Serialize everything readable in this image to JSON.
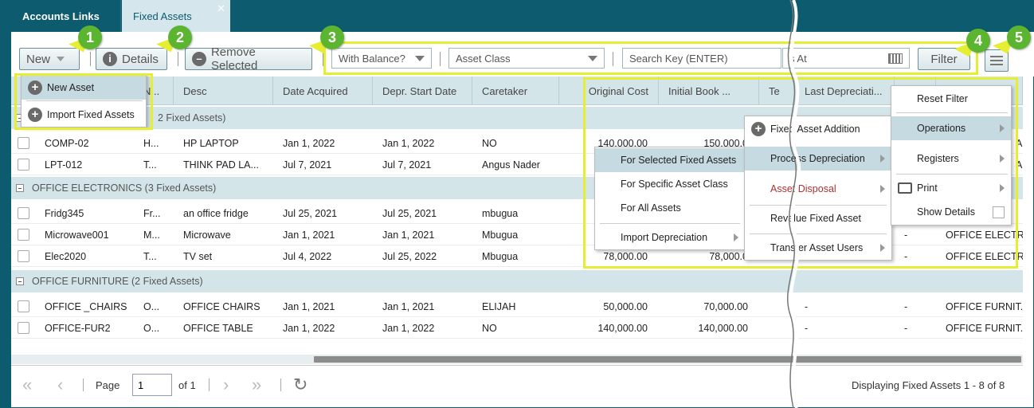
{
  "tabs": [
    {
      "label": "Accounts Links"
    },
    {
      "label": "Fixed Assets",
      "close": "✕"
    }
  ],
  "toolbar": {
    "new_label": "New",
    "details_label": "Details",
    "remove_label": "Remove Selected",
    "balance_value": "With Balance?",
    "asset_class_placeholder": "Asset Class",
    "search_placeholder": "Search Key (ENTER)",
    "as_at_placeholder": "s At",
    "filter_label": "Filter"
  },
  "new_menu": {
    "items": [
      "New Asset",
      "Import Fixed Assets"
    ]
  },
  "columns": [
    "N...",
    "Desc",
    "Date Acquired",
    "Depr. Start Date",
    "Caretaker",
    "Original Cost",
    "Initial Book ...",
    "Te",
    "Last Depreciati...",
    "",
    "Asset Class"
  ],
  "groups": [
    {
      "label": "2 Fixed Assets)"
    },
    {
      "label": "OFFICE ELECTRONICS (3 Fixed Assets)"
    },
    {
      "label": "OFFICE FURNITURE (2 Fixed Assets)"
    }
  ],
  "rows": [
    {
      "code": "COMP-02",
      "n": "H...",
      "desc": "HP LAPTOP",
      "acq": "Jan 1, 2022",
      "depr": "Jan 1, 2022",
      "caretaker": "NO",
      "cost": "140,000.00",
      "book": "150,000.0",
      "last": "",
      "dash": "",
      "cls": "A..."
    },
    {
      "code": "LPT-012",
      "n": "T...",
      "desc": "THINK PAD LA...",
      "acq": "Jul 7, 2021",
      "depr": "Jul 7, 2021",
      "caretaker": "Angus Nader",
      "cost": "",
      "book": "",
      "last": "",
      "dash": "",
      "cls": "A..."
    },
    {
      "code": "Fridg345",
      "n": "Fr...",
      "desc": "an office fridge",
      "acq": "Jul 25, 2021",
      "depr": "Jul 25, 2021",
      "caretaker": "mbugua",
      "cost": "",
      "book": "",
      "last": "",
      "dash": "",
      "cls": ""
    },
    {
      "code": "Microwave001",
      "n": "M...",
      "desc": "Microwave",
      "acq": "Jan 1, 2021",
      "depr": "Jan 1, 2021",
      "caretaker": "Mbugua",
      "cost": "",
      "book": "",
      "last": "",
      "dash": "-",
      "cls": "OFFICE ELECTR..."
    },
    {
      "code": "Elec2020",
      "n": "T...",
      "desc": "TV set",
      "acq": "Jul 4, 2022",
      "depr": "Jul 25, 2022",
      "caretaker": "Mbugua",
      "cost": "78,000.00",
      "book": "78,000.0",
      "last": "",
      "dash": "-",
      "cls": "OFFICE ELECTR..."
    },
    {
      "code": "OFFICE _CHAIRS",
      "n": "O...",
      "desc": "OFFICE CHAIRS",
      "acq": "Jan 1, 2021",
      "depr": "Jan 1, 2021",
      "caretaker": "ELIJAH",
      "cost": "50,000.00",
      "book": "70,000.00",
      "last": "-",
      "dash": "-",
      "cls": "OFFICE FURNIT..."
    },
    {
      "code": "OFFICE-FUR2",
      "n": "O...",
      "desc": "OFFICE TABLE",
      "acq": "Jan 1, 2022",
      "depr": "Jan 1, 2022",
      "caretaker": "NO",
      "cost": "140,000.00",
      "book": "140,000.00",
      "last": "-",
      "dash": "-",
      "cls": "OFFICE FURNIT..."
    }
  ],
  "options_menu": {
    "reset": "Reset Filter",
    "operations": "Operations",
    "registers": "Registers",
    "print": "Print",
    "show_details": "Show Details"
  },
  "operations_menu": {
    "addition": "Fixed Asset Addition",
    "process": "Process Depreciation",
    "disposal": "Asset Disposal",
    "revalue": "Revalue Fixed Asset",
    "transfer": "Transfer Asset Users"
  },
  "depreciation_menu": {
    "selected": "For Selected Fixed Assets",
    "specific": "For Specific Asset Class",
    "all": "For All Assets",
    "import": "Import Depreciation"
  },
  "pager": {
    "page_label": "Page",
    "page_value": "1",
    "of_label": "of 1",
    "display": "Displaying Fixed Assets 1 - 8 of 8"
  },
  "badges": [
    "1",
    "2",
    "3",
    "4",
    "5"
  ],
  "colors": {
    "header": "#0d5b6e",
    "highlight": "#e6ee33",
    "badge": "#5cb531",
    "disposal": "#b03030"
  }
}
